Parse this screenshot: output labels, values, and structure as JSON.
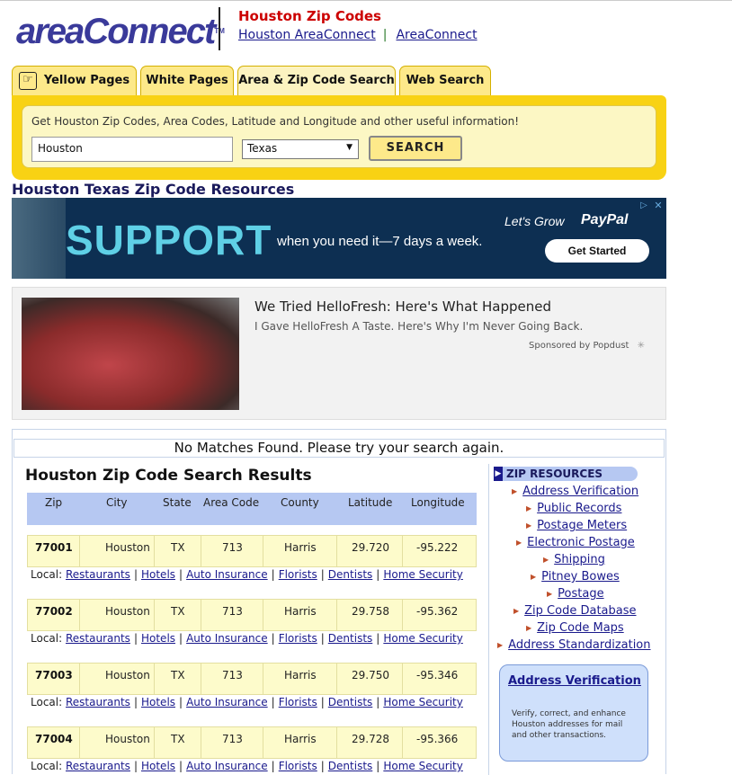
{
  "header": {
    "logo_text": "areaConnect",
    "logo_tm": "TM",
    "title": "Houston Zip Codes",
    "link1": "Houston AreaConnect",
    "link_sep": "|",
    "link2": "AreaConnect"
  },
  "tabs": [
    {
      "label": "Yellow Pages",
      "active": false
    },
    {
      "label": "White Pages",
      "active": false
    },
    {
      "label": "Area & Zip Code Search",
      "active": true
    },
    {
      "label": "Web Search",
      "active": false
    }
  ],
  "search": {
    "description": "Get Houston Zip Codes, Area Codes, Latitude and Longitude and other useful information!",
    "city_value": "Houston",
    "state_value": "Texas",
    "button_label": "SEARCH"
  },
  "resources_title": "Houston Texas Zip Code Resources",
  "ad_banner": {
    "headline": "SUPPORT",
    "subline": "when you need it—7 days a week.",
    "tagline": "Let's Grow",
    "brand": "PayPal",
    "cta": "Get Started"
  },
  "native_ad": {
    "title": "We Tried HelloFresh: Here's What Happened",
    "subtitle": "I Gave HelloFresh A Taste. Here's Why I'm Never Going Back.",
    "sponsor": "Sponsored by Popdust"
  },
  "results": {
    "no_matches": "No Matches Found. Please try your search again.",
    "title": "Houston Zip Code Search Results",
    "columns": [
      "Zip",
      "City",
      "State",
      "Area Code",
      "County",
      "Latitude",
      "Longitude"
    ],
    "local_label": "Local:",
    "local_links": [
      "Restaurants",
      "Hotels",
      "Auto Insurance",
      "Florists",
      "Dentists",
      "Home Security"
    ],
    "rows": [
      {
        "zip": "77001",
        "city": "Houston",
        "state": "TX",
        "area_code": "713",
        "county": "Harris",
        "lat": "29.720",
        "lon": "-95.222"
      },
      {
        "zip": "77002",
        "city": "Houston",
        "state": "TX",
        "area_code": "713",
        "county": "Harris",
        "lat": "29.758",
        "lon": "-95.362"
      },
      {
        "zip": "77003",
        "city": "Houston",
        "state": "TX",
        "area_code": "713",
        "county": "Harris",
        "lat": "29.750",
        "lon": "-95.346"
      },
      {
        "zip": "77004",
        "city": "Houston",
        "state": "TX",
        "area_code": "713",
        "county": "Harris",
        "lat": "29.728",
        "lon": "-95.366"
      }
    ]
  },
  "sidebar": {
    "heading": "ZIP RESOURCES",
    "items": [
      "Address Verification",
      "Public Records",
      "Postage Meters",
      "Electronic Postage",
      "Shipping",
      "Pitney Bowes",
      "Postage",
      "Zip Code Database",
      "Zip Code Maps",
      "Address Standardization"
    ],
    "box_title": "Address Verification",
    "box_desc": "Verify, correct, and enhance Houston addresses for mail and other transactions."
  },
  "colors": {
    "tab_yellow": "#fde98a",
    "search_yellow": "#f8d214",
    "header_red": "#cc0000",
    "link_blue": "#1a1a8c",
    "table_header": "#b6c8f2",
    "row_bg": "#fdfbcb"
  }
}
